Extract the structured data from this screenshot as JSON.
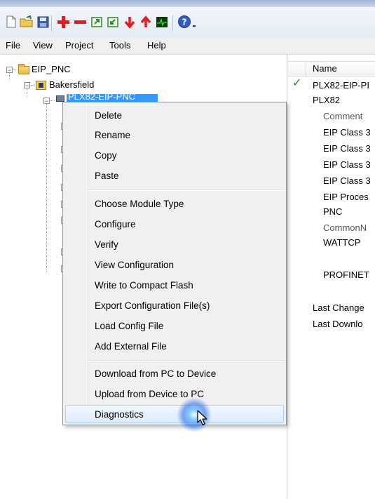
{
  "menubar": {
    "items": [
      "File",
      "View",
      "Project",
      "Tools",
      "Help"
    ]
  },
  "toolbar": {
    "buttons": [
      "new-file-icon",
      "open-folder-icon",
      "save-icon",
      "add-icon",
      "remove-icon",
      "export-icon",
      "import-icon",
      "download-icon",
      "upload-icon",
      "diagnostics-icon",
      "help-icon"
    ]
  },
  "tree": {
    "root": "EIP_PNC",
    "site": "Bakersfield",
    "module": "PLX82-EIP-PNC"
  },
  "right_pane": {
    "header": "Name",
    "rows": [
      "PLX82-EIP-PI",
      "PLX82",
      "Comment",
      "EIP Class 3",
      "EIP Class 3",
      "EIP Class 3",
      "EIP Class 3",
      "EIP Proces",
      "PNC",
      "CommonN",
      "WATTCP",
      "PROFINET",
      "Last Change",
      "Last Downlo"
    ]
  },
  "context_menu": {
    "group1": [
      "Delete",
      "Rename",
      "Copy",
      "Paste"
    ],
    "group2": [
      "Choose Module Type",
      "Configure",
      "Verify",
      "View Configuration",
      "Write to Compact Flash",
      "Export Configuration File(s)",
      "Load Config File",
      "Add External File"
    ],
    "group3": [
      "Download from PC to Device",
      "Upload from Device to PC",
      "Diagnostics"
    ],
    "hovered": "Diagnostics"
  },
  "colors": {
    "selection": "#3399ff",
    "menu_bg": "#f0f0f0",
    "hover_border": "#aecff7",
    "check": "#1e8c1e"
  }
}
